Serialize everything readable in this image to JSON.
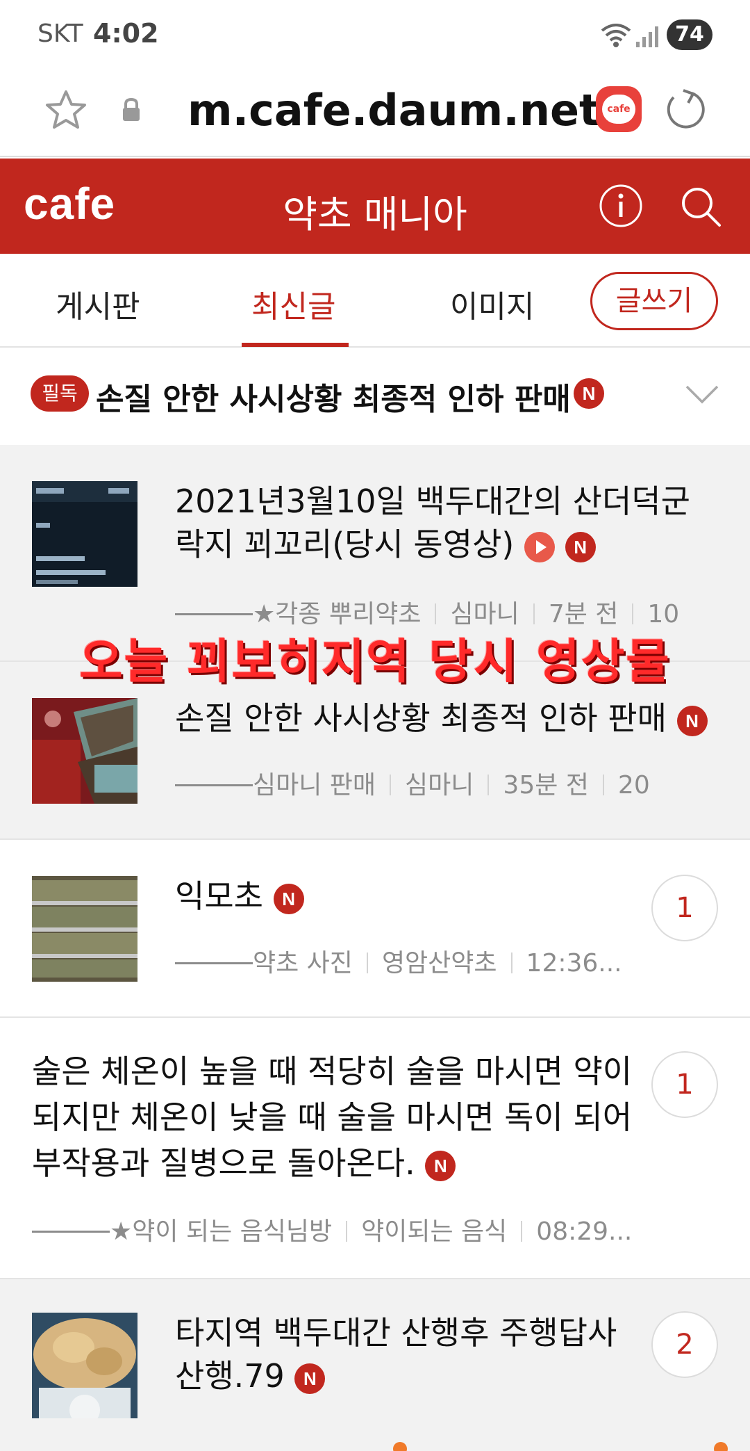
{
  "status_bar": {
    "carrier": "SKT",
    "time": "4:02",
    "battery": "74"
  },
  "browser": {
    "url": "m.cafe.daum.net"
  },
  "header": {
    "logo": "cafe",
    "title": "약초 매니아"
  },
  "tabs": {
    "items": [
      {
        "label": "게시판"
      },
      {
        "label": "최신글"
      },
      {
        "label": "이미지"
      }
    ],
    "active": "최신글",
    "write_label": "글쓰기"
  },
  "notice": {
    "badge": "필독",
    "text": "손질 안한 사시상황 최종적 인하 판매",
    "new_badge": "N"
  },
  "overlay_caption": "오늘 꾀보히지역 당시 영상물",
  "posts": [
    {
      "title": "2021년3월10일 백두대간의 산더덕군락지 꾀꼬리(당시 동영상)",
      "new_badge": "N",
      "category": "★각종 뿌리약초",
      "author": "심마니",
      "time": "7분 전",
      "views": "10"
    },
    {
      "title": "손질 안한 사시상황 최종적 인하 판매",
      "new_badge": "N",
      "category": "심마니 판매",
      "author": "심마니",
      "time": "35분 전",
      "views": "20"
    },
    {
      "title": "익모초",
      "new_badge": "N",
      "category": "약초 사진",
      "author": "영암산약초",
      "time": "12:36...",
      "comments": "1"
    },
    {
      "title": "술은 체온이 높을 때 적당히 술을 마시면 약이 되지만 체온이 낮을 때 술을 마시면 독이 되어 부작용과 질병으로 돌아온다.",
      "new_badge": "N",
      "category": "★약이 되는 음식님방",
      "author": "약이되는 음식",
      "time": "08:29...",
      "comments": "1"
    },
    {
      "title": "타지역 백두대간 산행후 주행답사 산행.79",
      "new_badge": "N",
      "comments": "2"
    }
  ],
  "colors": {
    "brand": "#c1271e",
    "overlay": "#ff2a2a"
  }
}
